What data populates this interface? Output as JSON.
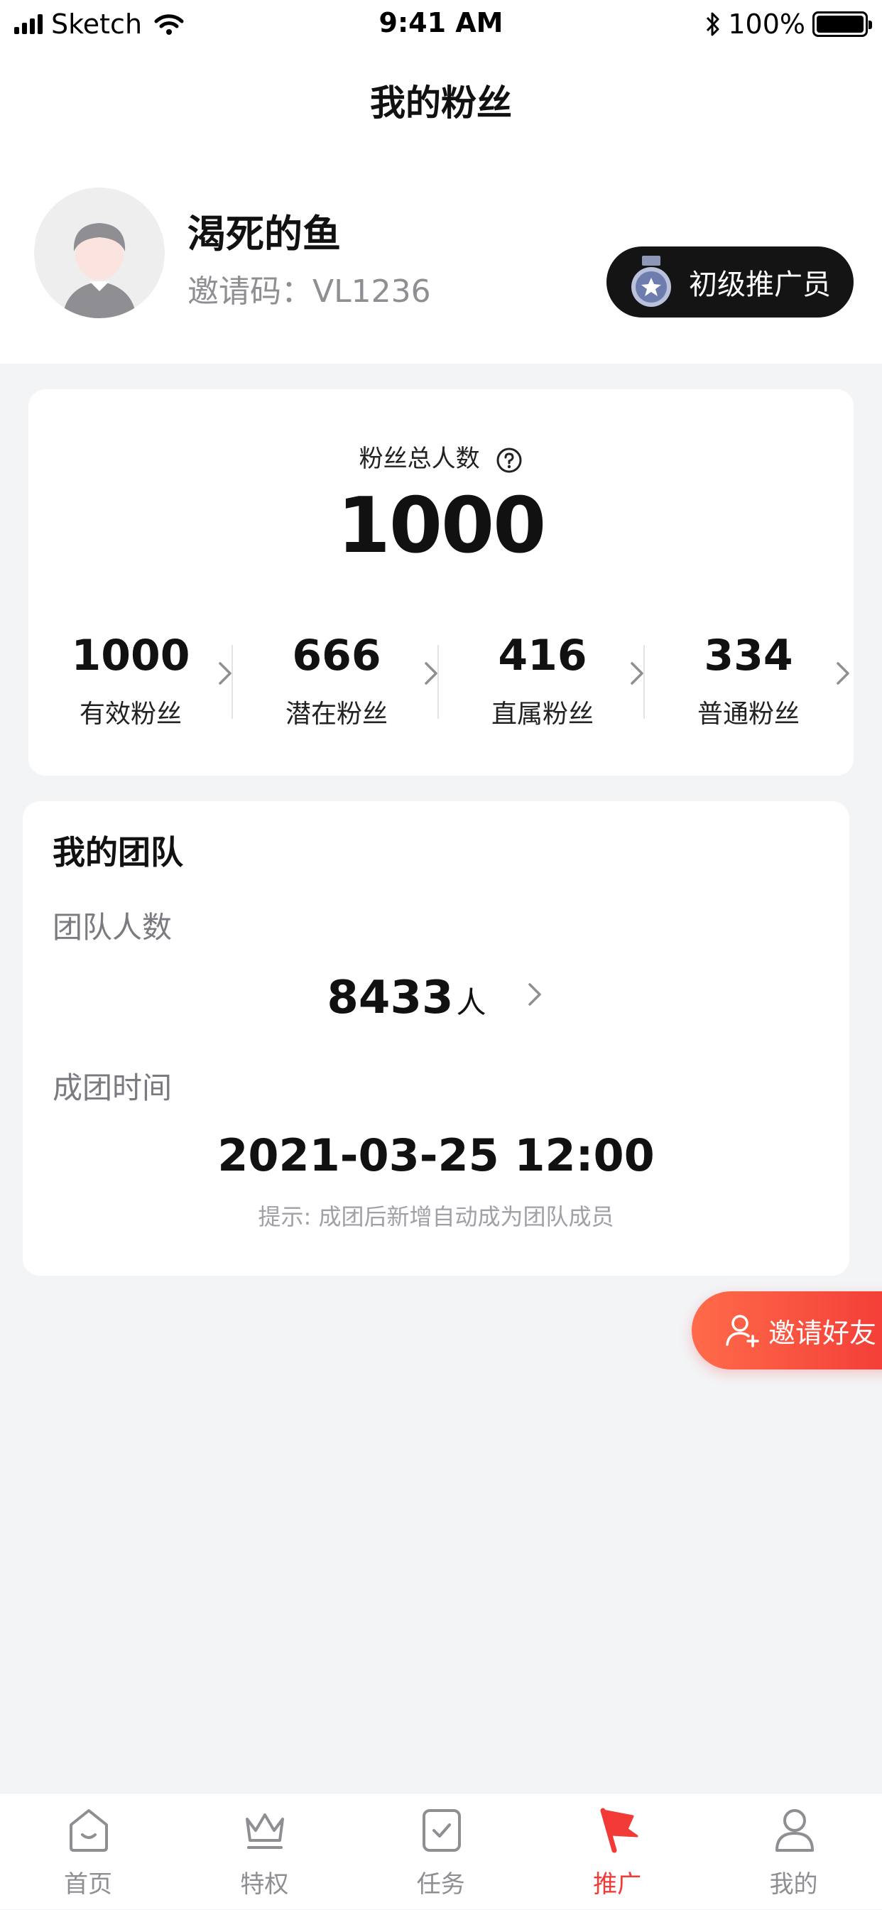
{
  "status_bar": {
    "carrier": "Sketch",
    "time": "9:41 AM",
    "battery": "100%"
  },
  "nav": {
    "title": "我的粉丝"
  },
  "profile": {
    "name": "渴死的鱼",
    "invite_code": "邀请码：VL1236",
    "level": "初级推广员"
  },
  "fans": {
    "total_label": "粉丝总人数",
    "total": "1000",
    "stats": [
      {
        "value": "1000",
        "label": "有效粉丝"
      },
      {
        "value": "666",
        "label": "潜在粉丝"
      },
      {
        "value": "416",
        "label": "直属粉丝"
      },
      {
        "value": "334",
        "label": "普通粉丝"
      }
    ]
  },
  "team": {
    "title": "我的团队",
    "count_label": "团队人数",
    "count": "8433",
    "count_unit": "人",
    "formed_label": "成团时间",
    "formed_time": "2021-03-25 12:00",
    "hint": "提示: 成团后新增自动成为团队成员"
  },
  "invite_button": {
    "label": "邀请好友"
  },
  "tabs": [
    {
      "label": "首页",
      "icon": "home-icon"
    },
    {
      "label": "特权",
      "icon": "crown-icon"
    },
    {
      "label": "任务",
      "icon": "task-icon"
    },
    {
      "label": "推广",
      "icon": "flag-icon",
      "active": true
    },
    {
      "label": "我的",
      "icon": "user-icon"
    }
  ],
  "colors": {
    "accent": "#f23a36",
    "badge_bg": "#141414",
    "page_bg": "#f3f4f6"
  }
}
